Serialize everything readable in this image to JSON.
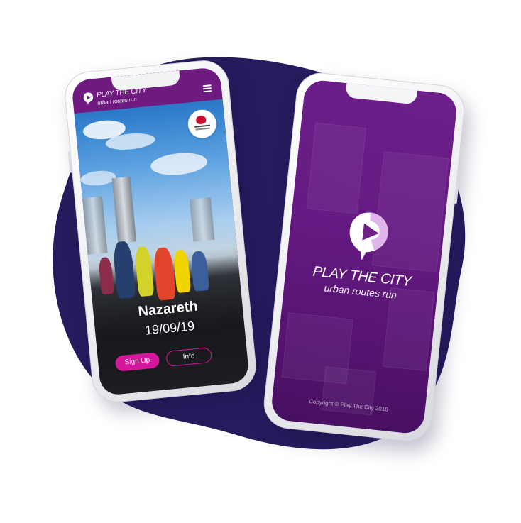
{
  "colors": {
    "blob": "#271b5e",
    "brand_purple": "#6d1f8a",
    "accent_pink": "#d5179b"
  },
  "left_screen": {
    "header": {
      "brand_title": "PLAY THE CITY",
      "brand_subtitle": "urban routes run",
      "menu_icon": "hamburger-icon"
    },
    "hero": {
      "city": "Nazareth",
      "date": "19/09/19"
    },
    "buttons": {
      "signup_label": "Sign Up",
      "info_label": "Info"
    }
  },
  "right_screen": {
    "brand_title": "PLAY THE CITY",
    "brand_subtitle": "urban routes run",
    "copyright": "Copyright © Play The City 2018"
  }
}
